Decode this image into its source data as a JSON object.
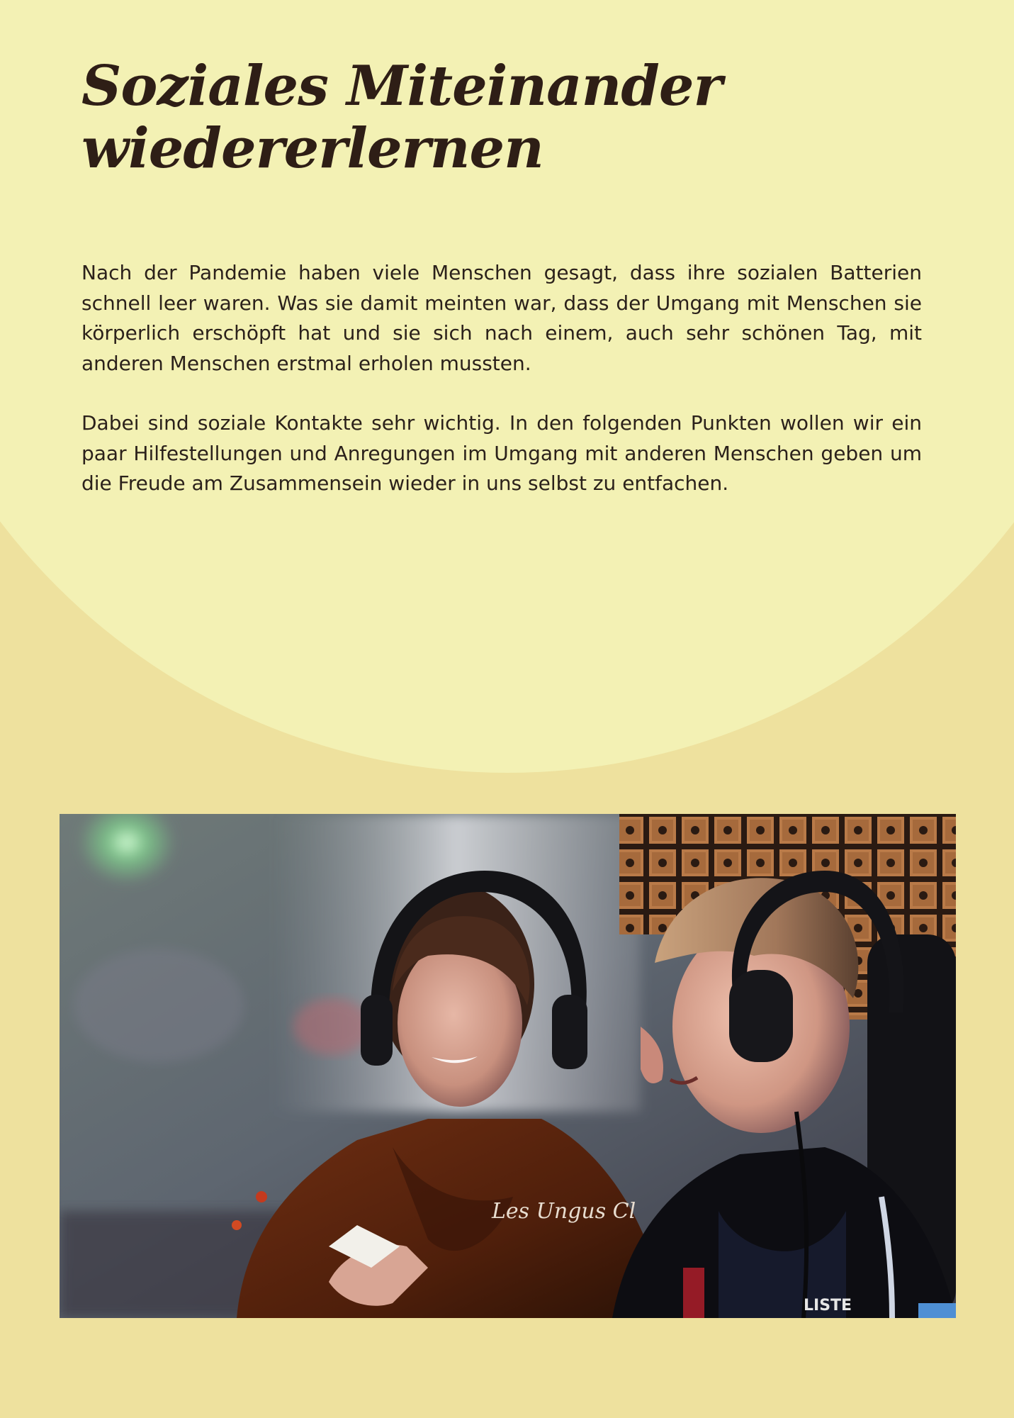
{
  "document": {
    "title_line_1": "Soziales Miteinander",
    "title_line_2": "wiedererlernen",
    "paragraphs": [
      "Nach der Pandemie haben viele Menschen gesagt, dass ihre sozialen Batterien schnell leer waren. Was sie damit meinten war, dass der Umgang mit Menschen sie körperlich erschöpft hat und sie sich nach einem, auch sehr schönen Tag, mit anderen Menschen erstmal erholen mussten.",
      "Dabei sind soziale Kontakte sehr wichtig. In den folgenden Punkten wollen wir ein paar Hilfestellungen und Anregungen im Umgang mit anderen Menschen geben um die Freude am Zusammensein wieder in uns selbst zu entfachen."
    ]
  },
  "photo": {
    "hoodie_text": "Les Ungus Cl",
    "jacket_text": "LISTE"
  },
  "colors": {
    "page_background": "#eee19e",
    "circle": "#f3f1b4",
    "title": "#2e1e16",
    "text": "#2b211b"
  }
}
